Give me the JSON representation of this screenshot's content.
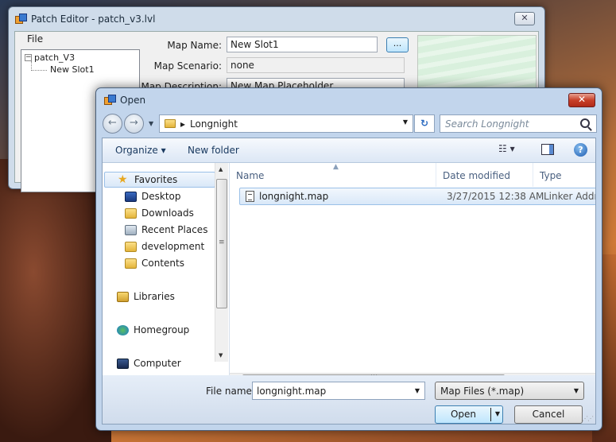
{
  "patch_editor": {
    "title": "Patch Editor - patch_v3.lvl",
    "close_glyph": "✕",
    "menu_file": "File",
    "tree_root": "patch_V3",
    "tree_child": "New Slot1",
    "map_name_label": "Map Name:",
    "map_name_value": "New Slot1",
    "browse_label": "...",
    "map_scenario_label": "Map Scenario:",
    "map_scenario_value": "none",
    "map_description_label": "Map Description:",
    "map_description_value": "New Map Placeholder"
  },
  "open_dialog": {
    "title": "Open",
    "close_glyph": "✕",
    "back_glyph": "←",
    "forward_glyph": "→",
    "path_separator": "▸",
    "path": "Longnight",
    "refresh_glyph": "↻",
    "search_placeholder": "Search Longnight",
    "toolbar": {
      "organize": "Organize ▾",
      "new_folder": "New folder",
      "views_glyph": "☷ ▾",
      "help_glyph": "?"
    },
    "nav": {
      "favorites": "Favorites",
      "items": [
        "Desktop",
        "Downloads",
        "Recent Places",
        "development",
        "Contents"
      ],
      "libraries": "Libraries",
      "homegroup": "Homegroup",
      "computer": "Computer"
    },
    "columns": {
      "name": "Name",
      "date_modified": "Date modified",
      "type": "Type"
    },
    "files": [
      {
        "name": "longnight.map",
        "date": "3/27/2015 12:38 AM",
        "type": "Linker Address Map"
      }
    ],
    "file_name_label": "File name:",
    "file_name_value": "longnight.map",
    "file_type_value": "Map Files (*.map)",
    "open_button": "Open",
    "cancel_button": "Cancel"
  }
}
